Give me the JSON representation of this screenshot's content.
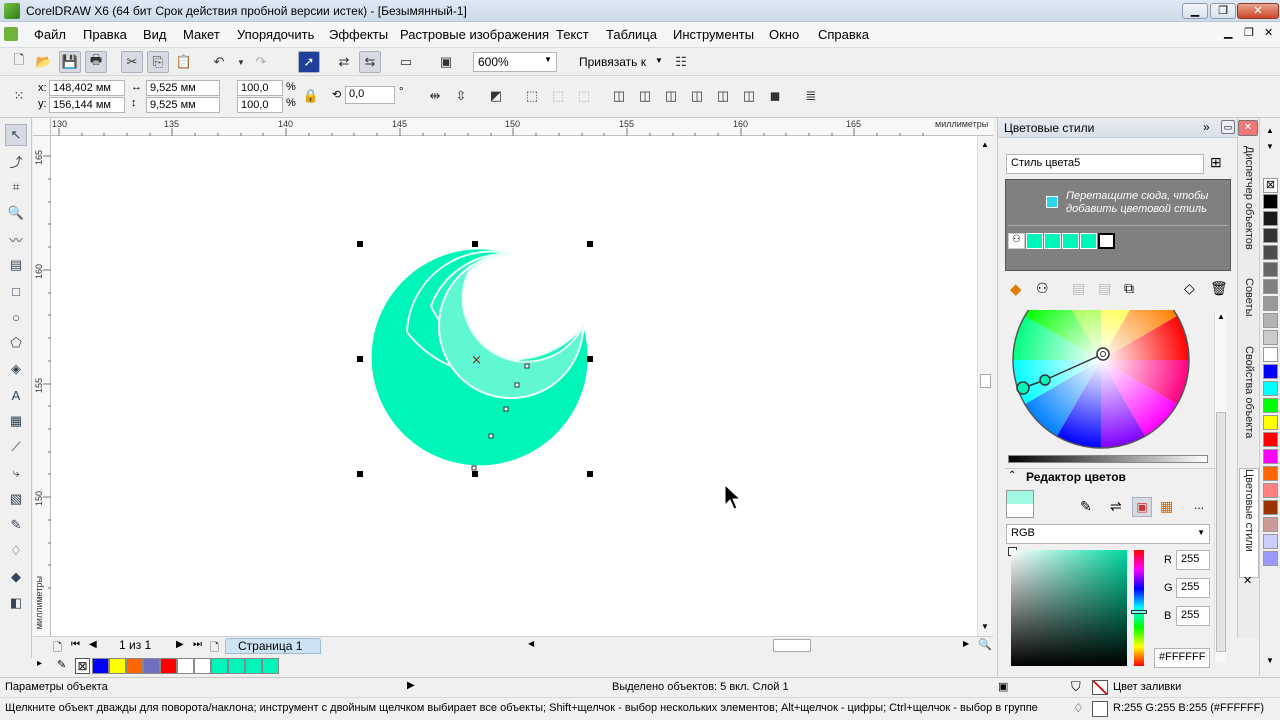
{
  "window": {
    "title": "CorelDRAW X6 (64 бит Срок действия пробной версии истек) - [Безымянный-1]",
    "min": "▁",
    "max": "❐",
    "close": "✕"
  },
  "menu": [
    "Файл",
    "Правка",
    "Вид",
    "Макет",
    "Упорядочить",
    "Эффекты",
    "Растровые изображения",
    "Текст",
    "Таблица",
    "Инструменты",
    "Окно",
    "Справка"
  ],
  "menu_accel": [
    "Ф",
    "П",
    "В",
    "М",
    "У",
    "Э",
    "Р",
    "Т",
    "Т",
    "И",
    "О",
    "С"
  ],
  "toolbar": {
    "zoom": "600%",
    "snap": "Привязать к"
  },
  "props": {
    "x": "148,402 мм",
    "y": "156,144 мм",
    "x_label": "x:",
    "y_label": "y:",
    "width": "9,525 мм",
    "height": "9,525 мм",
    "scale_x": "100,0",
    "scale_y": "100,0",
    "pct": "%",
    "angle": "0,0",
    "deg": "°"
  },
  "ruler": {
    "h_ticks": [
      "130",
      "135",
      "140",
      "145",
      "150",
      "155",
      "160",
      "165"
    ],
    "h_unit": "миллиметры",
    "v_ticks": [
      "165",
      "160",
      "155",
      "150"
    ],
    "v_unit": "миллиметры"
  },
  "pagebar": {
    "pages": "1 из 1",
    "page_tab": "Страница 1"
  },
  "palette_colors": [
    "#0000ff",
    "#ffff00",
    "#ff6600",
    "#6f6fbf",
    "#ff0000",
    "#ffffff",
    "#ffffff",
    "#00f5b8",
    "#00f5b8",
    "#00f5b8",
    "#00f5b8"
  ],
  "status": {
    "left": "Параметры объекта",
    "middle": "Выделено объектов: 5 вкл. Слой 1",
    "fill_label": "Цвет заливки",
    "hint": "Щелкните объект дважды для поворота/наклона; инструмент с двойным щелчком выбирает все объекты; Shift+щелчок - выбор нескольких элементов; Alt+щелчок - цифры; Ctrl+щелчок - выбор в группе",
    "color_readout": "R:255 G:255 B:255 (#FFFFFF)"
  },
  "docker": {
    "title": "Цветовые стили",
    "style_name": "Стиль цвета5",
    "drop_hint": "Перетащите сюда, чтобы добавить цветовой стиль",
    "editor_title": "Редактор цветов",
    "model": "RGB",
    "r_label": "R",
    "g_label": "G",
    "b_label": "B",
    "r": "255",
    "g": "255",
    "b": "255",
    "hex": "#FFFFFF",
    "more": "..."
  },
  "side_tabs": [
    "Диспетчер объектов",
    "Советы",
    "Свойства объекта",
    "Цветовые стили"
  ],
  "right_palette": [
    "#000000",
    "#1a1a1a",
    "#333333",
    "#4d4d4d",
    "#666666",
    "#808080",
    "#999999",
    "#b3b3b3",
    "#cccccc",
    "#ffffff",
    "#0000ff",
    "#00ffff",
    "#00ff00",
    "#ffff00",
    "#ff0000",
    "#ff00ff",
    "#ff6600",
    "#ff8080",
    "#993300",
    "#cc9999",
    "#ccccff",
    "#9999ff"
  ],
  "accent": "#00f5b8"
}
